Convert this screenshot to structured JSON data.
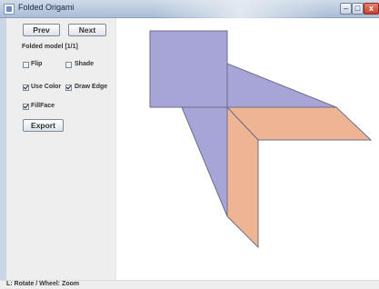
{
  "window": {
    "title": "Folded Origami",
    "icon": "java-window-icon",
    "controls": {
      "minimize": "–",
      "maximize": "□",
      "close": "x"
    }
  },
  "sidebar": {
    "prev_label": "Prev",
    "next_label": "Next",
    "model_label": "Folded model [1/1]",
    "checkboxes": {
      "flip": {
        "label": "Flip",
        "checked": false
      },
      "shade": {
        "label": "Shade",
        "checked": false
      },
      "use_color": {
        "label": "Use Color",
        "checked": true
      },
      "draw_edge": {
        "label": "Draw Edge",
        "checked": true
      },
      "fill_face": {
        "label": "FillFace",
        "checked": true
      }
    },
    "export_label": "Export"
  },
  "status": {
    "text": "L: Rotate / Wheel: Zoom"
  },
  "colors": {
    "front_face": "#a7a4d8",
    "back_face": "#eeb595",
    "edge": "#6e6e86"
  }
}
